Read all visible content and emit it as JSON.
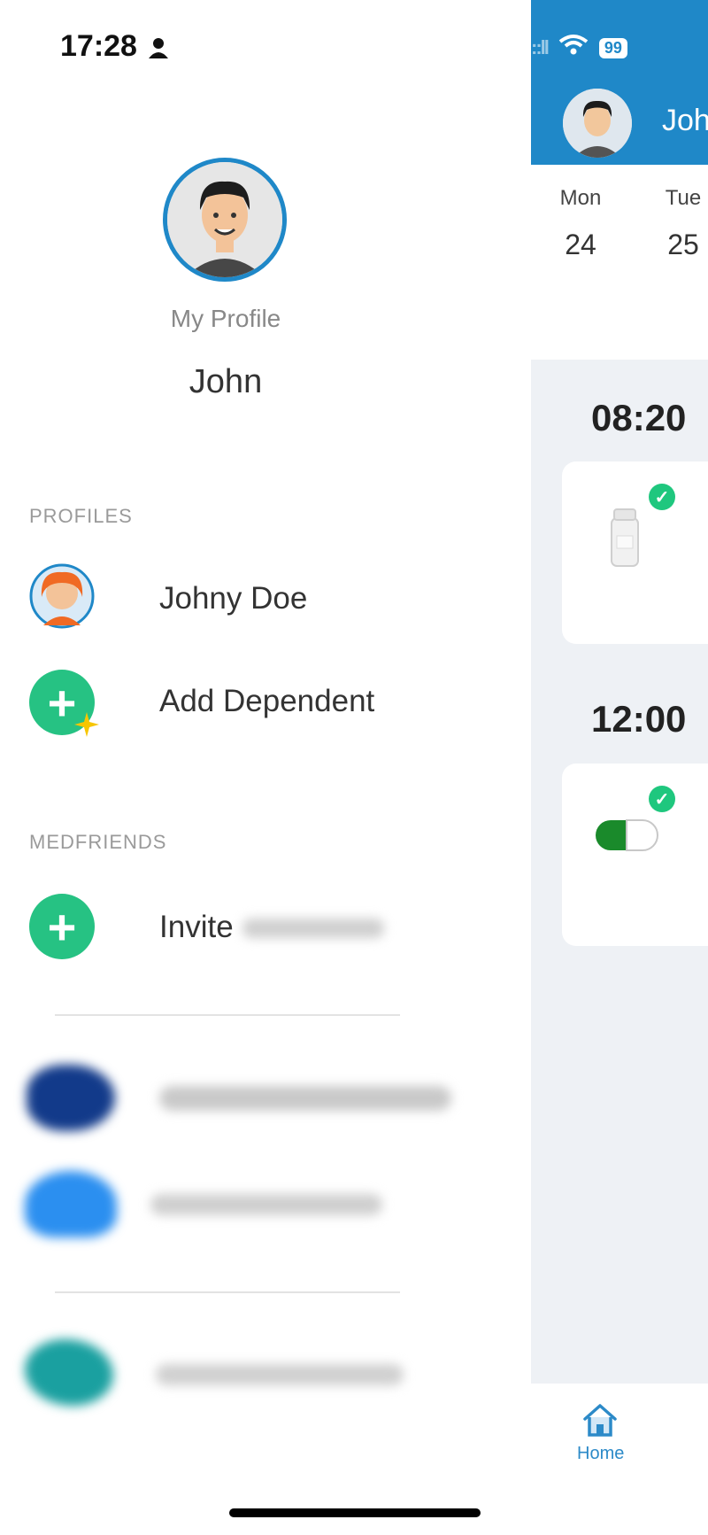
{
  "status_bar": {
    "time": "17:28",
    "battery": "99"
  },
  "drawer": {
    "my_profile_label": "My Profile",
    "my_profile_name": "John",
    "sections": {
      "profiles": "PROFILES",
      "medfriends": "MEDFRIENDS"
    },
    "profiles": [
      {
        "name": "Johny Doe"
      }
    ],
    "add_dependent_label": "Add Dependent",
    "invite_label": "Invite"
  },
  "app": {
    "header_title": "Joh",
    "week": [
      {
        "day": "Mon",
        "date": "24"
      },
      {
        "day": "Tue",
        "date": "25"
      }
    ],
    "schedule": [
      {
        "time": "08:20"
      },
      {
        "time": "12:00"
      }
    ],
    "tab_home_label": "Home"
  }
}
